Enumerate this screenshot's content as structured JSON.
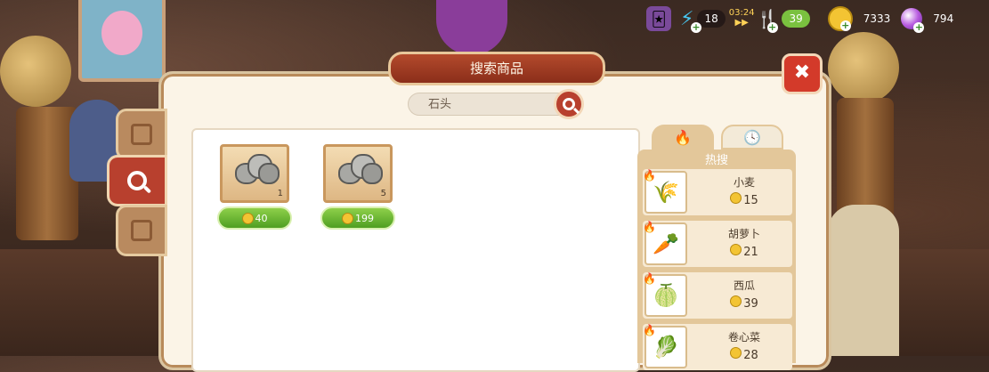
{
  "hud": {
    "energy": "18",
    "timer": "03:24",
    "food": "39",
    "coins": "7333",
    "gems": "794"
  },
  "dialog": {
    "title": "搜索商品"
  },
  "search": {
    "value": "石头"
  },
  "results": [
    {
      "quantity": "1",
      "price": "40"
    },
    {
      "quantity": "5",
      "price": "199"
    }
  ],
  "hot": {
    "header": "热搜",
    "items": [
      {
        "name": "小麦",
        "price": "15",
        "icon": "wheat-icon"
      },
      {
        "name": "胡萝卜",
        "price": "21",
        "icon": "carrot-icon"
      },
      {
        "name": "西瓜",
        "price": "39",
        "icon": "watermelon-icon"
      },
      {
        "name": "卷心菜",
        "price": "28",
        "icon": "cabbage-icon"
      }
    ]
  },
  "colors": {
    "accent": "#b8402e",
    "price_button": "#6fbf35",
    "panel": "#fbf4e7"
  }
}
